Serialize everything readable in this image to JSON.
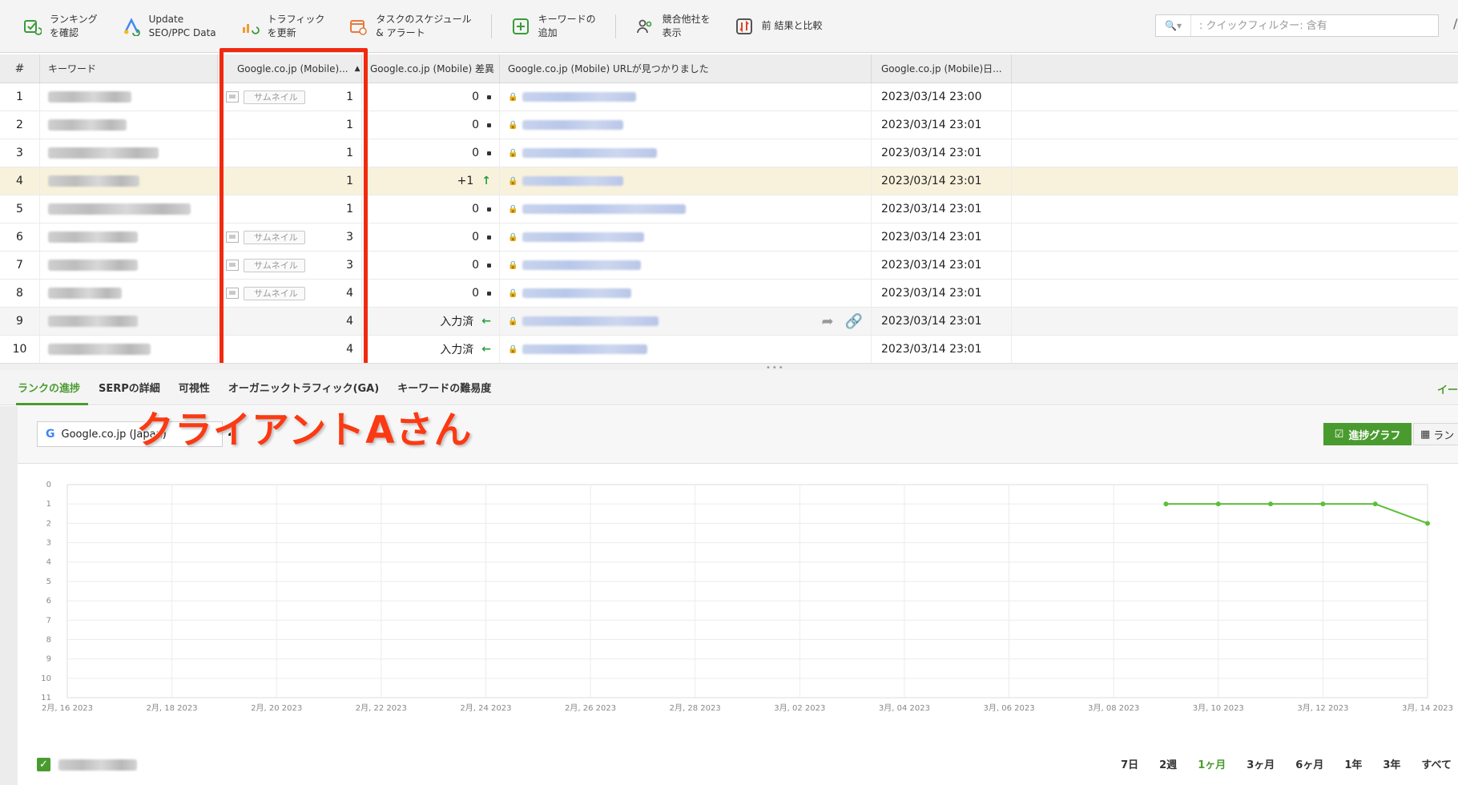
{
  "toolbar": {
    "buttons": [
      {
        "label": "ランキング\nを確認",
        "icon": "check-rankings-icon"
      },
      {
        "label": "Update\nSEO/PPC Data",
        "icon": "update-data-icon"
      },
      {
        "label": "トラフィック\nを更新",
        "icon": "traffic-refresh-icon"
      },
      {
        "label": "タスクのスケジュール\n& アラート",
        "icon": "schedule-alert-icon"
      },
      {
        "label": "キーワードの\n追加",
        "icon": "add-keyword-icon"
      },
      {
        "label": "競合他社を\n表示",
        "icon": "competitors-icon"
      },
      {
        "label": "前 結果と比較",
        "icon": "compare-icon"
      }
    ],
    "filter_placeholder": ": クイックフィルター: 含有"
  },
  "table": {
    "headers": {
      "num": "#",
      "keyword": "キーワード",
      "rank": "Google.co.jp (Mobile)...",
      "diff": "Google.co.jp (Mobile) 差異",
      "url": "Google.co.jp (Mobile) URLが見つかりました",
      "date": "Google.co.jp (Mobile)日..."
    },
    "thumb_label": "サムネイル",
    "rows": [
      {
        "n": "1",
        "thumb": true,
        "rank": "1",
        "diff": "0",
        "diff_kind": "dot",
        "date": "2023/03/14 23:00",
        "kw_w": 104,
        "url_w": 142
      },
      {
        "n": "2",
        "thumb": false,
        "rank": "1",
        "diff": "0",
        "diff_kind": "dot",
        "date": "2023/03/14 23:01",
        "kw_w": 98,
        "url_w": 126
      },
      {
        "n": "3",
        "thumb": false,
        "rank": "1",
        "diff": "0",
        "diff_kind": "dot",
        "date": "2023/03/14 23:01",
        "kw_w": 138,
        "url_w": 168
      },
      {
        "n": "4",
        "thumb": false,
        "rank": "1",
        "diff": "+1",
        "diff_kind": "up",
        "date": "2023/03/14 23:01",
        "kw_w": 114,
        "url_w": 126
      },
      {
        "n": "5",
        "thumb": false,
        "rank": "1",
        "diff": "0",
        "diff_kind": "dot",
        "date": "2023/03/14 23:01",
        "kw_w": 178,
        "url_w": 204
      },
      {
        "n": "6",
        "thumb": true,
        "rank": "3",
        "diff": "0",
        "diff_kind": "dot",
        "date": "2023/03/14 23:01",
        "kw_w": 112,
        "url_w": 152
      },
      {
        "n": "7",
        "thumb": true,
        "rank": "3",
        "diff": "0",
        "diff_kind": "dot",
        "date": "2023/03/14 23:01",
        "kw_w": 112,
        "url_w": 148
      },
      {
        "n": "8",
        "thumb": true,
        "rank": "4",
        "diff": "0",
        "diff_kind": "dot",
        "date": "2023/03/14 23:01",
        "kw_w": 92,
        "url_w": 136
      },
      {
        "n": "9",
        "thumb": false,
        "rank": "4",
        "diff": "入力済",
        "diff_kind": "left",
        "date": "2023/03/14 23:01",
        "kw_w": 112,
        "url_w": 170
      },
      {
        "n": "10",
        "thumb": false,
        "rank": "4",
        "diff": "入力済",
        "diff_kind": "left",
        "date": "2023/03/14 23:01",
        "kw_w": 128,
        "url_w": 156
      }
    ]
  },
  "annotation": "クライアントAさん",
  "tabs": [
    {
      "label": "ランクの進捗",
      "active": true
    },
    {
      "label": "SERPの詳細",
      "active": false
    },
    {
      "label": "可視性",
      "active": false
    },
    {
      "label": "オーガニックトラフィック(GA)",
      "active": false
    },
    {
      "label": "キーワードの難易度",
      "active": false
    }
  ],
  "tab_right": "イー",
  "chart_controls": {
    "engine": "Google.co.jp (Japan)",
    "count": "2",
    "progress_button": "進捗グラフ",
    "rank_button": "ラン"
  },
  "chart_data": {
    "type": "line",
    "ylim": [
      11,
      0
    ],
    "yticks": [
      "0",
      "1",
      "2",
      "3",
      "4",
      "5",
      "6",
      "7",
      "8",
      "9",
      "10",
      "11"
    ],
    "xticks": [
      "2月, 16 2023",
      "2月, 18 2023",
      "2月, 20 2023",
      "2月, 22 2023",
      "2月, 24 2023",
      "2月, 26 2023",
      "2月, 28 2023",
      "3月, 02 2023",
      "3月, 04 2023",
      "3月, 06 2023",
      "3月, 08 2023",
      "3月, 10 2023",
      "3月, 12 2023",
      "3月, 14 2023"
    ],
    "series": [
      {
        "color": "#5cbf3a",
        "points": [
          {
            "x": "2023-03-09",
            "y": 1
          },
          {
            "x": "2023-03-10",
            "y": 1
          },
          {
            "x": "2023-03-11",
            "y": 1
          },
          {
            "x": "2023-03-12",
            "y": 1
          },
          {
            "x": "2023-03-13",
            "y": 1
          },
          {
            "x": "2023-03-14",
            "y": 2
          }
        ]
      }
    ]
  },
  "ranges": [
    {
      "label": "7日",
      "active": false
    },
    {
      "label": "2週",
      "active": false
    },
    {
      "label": "1ヶ月",
      "active": true
    },
    {
      "label": "3ヶ月",
      "active": false
    },
    {
      "label": "6ヶ月",
      "active": false
    },
    {
      "label": "1年",
      "active": false
    },
    {
      "label": "3年",
      "active": false
    },
    {
      "label": "すべて",
      "active": false
    }
  ]
}
